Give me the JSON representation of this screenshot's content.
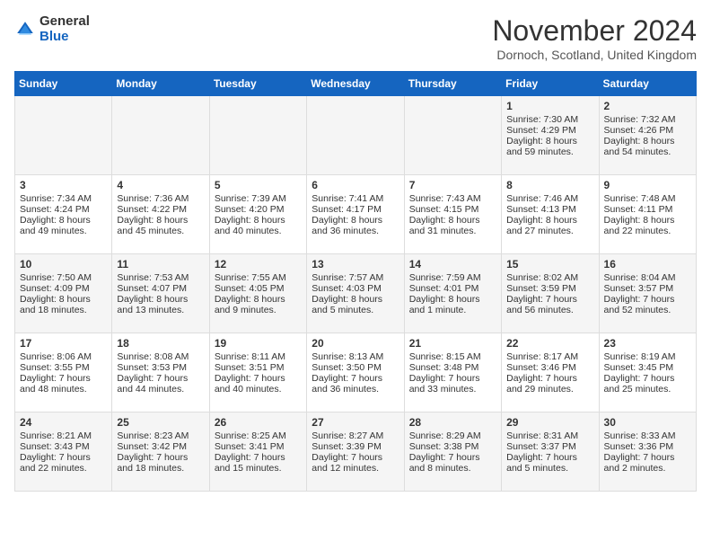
{
  "header": {
    "logo_general": "General",
    "logo_blue": "Blue",
    "month_title": "November 2024",
    "subtitle": "Dornoch, Scotland, United Kingdom"
  },
  "days_of_week": [
    "Sunday",
    "Monday",
    "Tuesday",
    "Wednesday",
    "Thursday",
    "Friday",
    "Saturday"
  ],
  "weeks": [
    [
      {
        "day": "",
        "sunrise": "",
        "sunset": "",
        "daylight": ""
      },
      {
        "day": "",
        "sunrise": "",
        "sunset": "",
        "daylight": ""
      },
      {
        "day": "",
        "sunrise": "",
        "sunset": "",
        "daylight": ""
      },
      {
        "day": "",
        "sunrise": "",
        "sunset": "",
        "daylight": ""
      },
      {
        "day": "",
        "sunrise": "",
        "sunset": "",
        "daylight": ""
      },
      {
        "day": "1",
        "sunrise": "Sunrise: 7:30 AM",
        "sunset": "Sunset: 4:29 PM",
        "daylight": "Daylight: 8 hours and 59 minutes."
      },
      {
        "day": "2",
        "sunrise": "Sunrise: 7:32 AM",
        "sunset": "Sunset: 4:26 PM",
        "daylight": "Daylight: 8 hours and 54 minutes."
      }
    ],
    [
      {
        "day": "3",
        "sunrise": "Sunrise: 7:34 AM",
        "sunset": "Sunset: 4:24 PM",
        "daylight": "Daylight: 8 hours and 49 minutes."
      },
      {
        "day": "4",
        "sunrise": "Sunrise: 7:36 AM",
        "sunset": "Sunset: 4:22 PM",
        "daylight": "Daylight: 8 hours and 45 minutes."
      },
      {
        "day": "5",
        "sunrise": "Sunrise: 7:39 AM",
        "sunset": "Sunset: 4:20 PM",
        "daylight": "Daylight: 8 hours and 40 minutes."
      },
      {
        "day": "6",
        "sunrise": "Sunrise: 7:41 AM",
        "sunset": "Sunset: 4:17 PM",
        "daylight": "Daylight: 8 hours and 36 minutes."
      },
      {
        "day": "7",
        "sunrise": "Sunrise: 7:43 AM",
        "sunset": "Sunset: 4:15 PM",
        "daylight": "Daylight: 8 hours and 31 minutes."
      },
      {
        "day": "8",
        "sunrise": "Sunrise: 7:46 AM",
        "sunset": "Sunset: 4:13 PM",
        "daylight": "Daylight: 8 hours and 27 minutes."
      },
      {
        "day": "9",
        "sunrise": "Sunrise: 7:48 AM",
        "sunset": "Sunset: 4:11 PM",
        "daylight": "Daylight: 8 hours and 22 minutes."
      }
    ],
    [
      {
        "day": "10",
        "sunrise": "Sunrise: 7:50 AM",
        "sunset": "Sunset: 4:09 PM",
        "daylight": "Daylight: 8 hours and 18 minutes."
      },
      {
        "day": "11",
        "sunrise": "Sunrise: 7:53 AM",
        "sunset": "Sunset: 4:07 PM",
        "daylight": "Daylight: 8 hours and 13 minutes."
      },
      {
        "day": "12",
        "sunrise": "Sunrise: 7:55 AM",
        "sunset": "Sunset: 4:05 PM",
        "daylight": "Daylight: 8 hours and 9 minutes."
      },
      {
        "day": "13",
        "sunrise": "Sunrise: 7:57 AM",
        "sunset": "Sunset: 4:03 PM",
        "daylight": "Daylight: 8 hours and 5 minutes."
      },
      {
        "day": "14",
        "sunrise": "Sunrise: 7:59 AM",
        "sunset": "Sunset: 4:01 PM",
        "daylight": "Daylight: 8 hours and 1 minute."
      },
      {
        "day": "15",
        "sunrise": "Sunrise: 8:02 AM",
        "sunset": "Sunset: 3:59 PM",
        "daylight": "Daylight: 7 hours and 56 minutes."
      },
      {
        "day": "16",
        "sunrise": "Sunrise: 8:04 AM",
        "sunset": "Sunset: 3:57 PM",
        "daylight": "Daylight: 7 hours and 52 minutes."
      }
    ],
    [
      {
        "day": "17",
        "sunrise": "Sunrise: 8:06 AM",
        "sunset": "Sunset: 3:55 PM",
        "daylight": "Daylight: 7 hours and 48 minutes."
      },
      {
        "day": "18",
        "sunrise": "Sunrise: 8:08 AM",
        "sunset": "Sunset: 3:53 PM",
        "daylight": "Daylight: 7 hours and 44 minutes."
      },
      {
        "day": "19",
        "sunrise": "Sunrise: 8:11 AM",
        "sunset": "Sunset: 3:51 PM",
        "daylight": "Daylight: 7 hours and 40 minutes."
      },
      {
        "day": "20",
        "sunrise": "Sunrise: 8:13 AM",
        "sunset": "Sunset: 3:50 PM",
        "daylight": "Daylight: 7 hours and 36 minutes."
      },
      {
        "day": "21",
        "sunrise": "Sunrise: 8:15 AM",
        "sunset": "Sunset: 3:48 PM",
        "daylight": "Daylight: 7 hours and 33 minutes."
      },
      {
        "day": "22",
        "sunrise": "Sunrise: 8:17 AM",
        "sunset": "Sunset: 3:46 PM",
        "daylight": "Daylight: 7 hours and 29 minutes."
      },
      {
        "day": "23",
        "sunrise": "Sunrise: 8:19 AM",
        "sunset": "Sunset: 3:45 PM",
        "daylight": "Daylight: 7 hours and 25 minutes."
      }
    ],
    [
      {
        "day": "24",
        "sunrise": "Sunrise: 8:21 AM",
        "sunset": "Sunset: 3:43 PM",
        "daylight": "Daylight: 7 hours and 22 minutes."
      },
      {
        "day": "25",
        "sunrise": "Sunrise: 8:23 AM",
        "sunset": "Sunset: 3:42 PM",
        "daylight": "Daylight: 7 hours and 18 minutes."
      },
      {
        "day": "26",
        "sunrise": "Sunrise: 8:25 AM",
        "sunset": "Sunset: 3:41 PM",
        "daylight": "Daylight: 7 hours and 15 minutes."
      },
      {
        "day": "27",
        "sunrise": "Sunrise: 8:27 AM",
        "sunset": "Sunset: 3:39 PM",
        "daylight": "Daylight: 7 hours and 12 minutes."
      },
      {
        "day": "28",
        "sunrise": "Sunrise: 8:29 AM",
        "sunset": "Sunset: 3:38 PM",
        "daylight": "Daylight: 7 hours and 8 minutes."
      },
      {
        "day": "29",
        "sunrise": "Sunrise: 8:31 AM",
        "sunset": "Sunset: 3:37 PM",
        "daylight": "Daylight: 7 hours and 5 minutes."
      },
      {
        "day": "30",
        "sunrise": "Sunrise: 8:33 AM",
        "sunset": "Sunset: 3:36 PM",
        "daylight": "Daylight: 7 hours and 2 minutes."
      }
    ]
  ]
}
